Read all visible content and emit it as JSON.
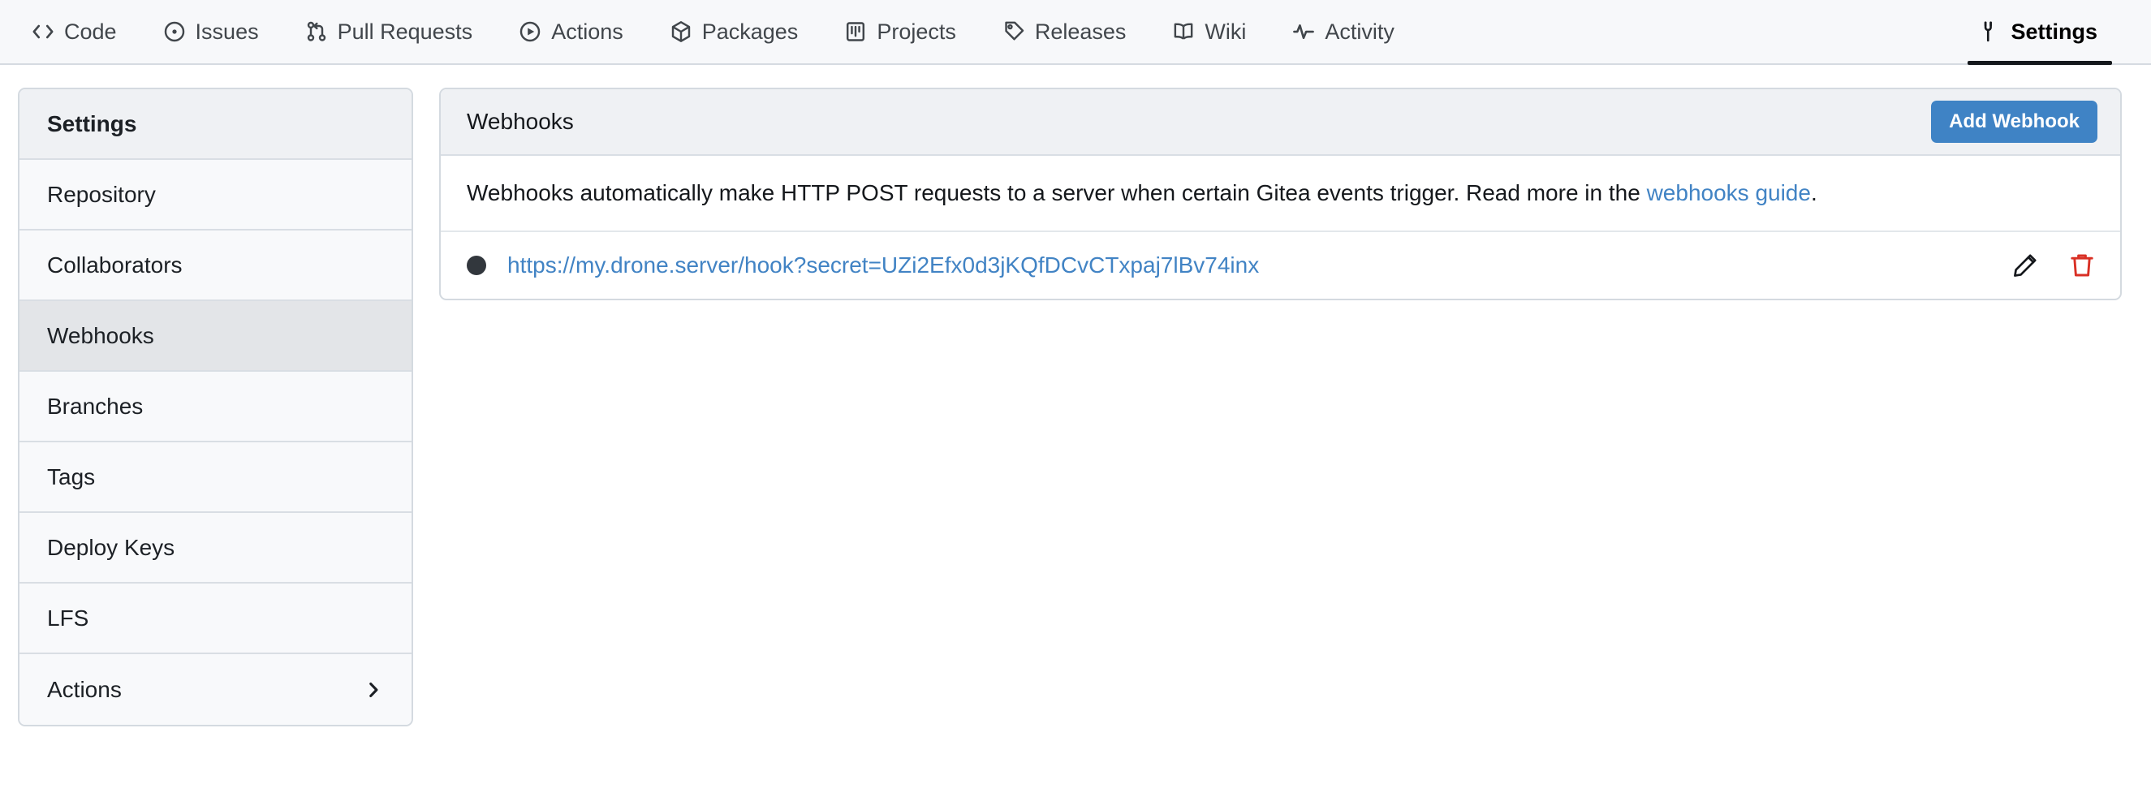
{
  "repo_nav": {
    "items": [
      {
        "label": "Code",
        "icon": "code-icon",
        "active": false
      },
      {
        "label": "Issues",
        "icon": "issue-opened-icon",
        "active": false
      },
      {
        "label": "Pull Requests",
        "icon": "git-pull-request-icon",
        "active": false
      },
      {
        "label": "Actions",
        "icon": "play-icon",
        "active": false
      },
      {
        "label": "Packages",
        "icon": "package-icon",
        "active": false
      },
      {
        "label": "Projects",
        "icon": "project-icon",
        "active": false
      },
      {
        "label": "Releases",
        "icon": "tag-icon",
        "active": false
      },
      {
        "label": "Wiki",
        "icon": "book-icon",
        "active": false
      },
      {
        "label": "Activity",
        "icon": "pulse-icon",
        "active": false
      }
    ],
    "settings": {
      "label": "Settings",
      "icon": "tools-icon",
      "active": true
    }
  },
  "sidebar": {
    "header": "Settings",
    "items": [
      {
        "label": "Repository",
        "active": false,
        "chevron": false
      },
      {
        "label": "Collaborators",
        "active": false,
        "chevron": false
      },
      {
        "label": "Webhooks",
        "active": true,
        "chevron": false
      },
      {
        "label": "Branches",
        "active": false,
        "chevron": false
      },
      {
        "label": "Tags",
        "active": false,
        "chevron": false
      },
      {
        "label": "Deploy Keys",
        "active": false,
        "chevron": false
      },
      {
        "label": "LFS",
        "active": false,
        "chevron": false
      },
      {
        "label": "Actions",
        "active": false,
        "chevron": true
      }
    ]
  },
  "panel": {
    "title": "Webhooks",
    "add_button": "Add Webhook",
    "description": {
      "before_link": "Webhooks automatically make HTTP POST requests to a server when certain Gitea events trigger. Read more in the ",
      "link_text": "webhooks guide",
      "after_link": "."
    },
    "webhooks": [
      {
        "status": "inactive",
        "url": "https://my.drone.server/hook?secret=UZi2Efx0d3jKQfDCvCTxpaj7lBv74inx",
        "edit_icon": "pencil-icon",
        "delete_icon": "trash-icon"
      }
    ]
  },
  "colors": {
    "accent_blue": "#4183c4",
    "button_blue": "#3f83c5",
    "delete_red": "#d93025",
    "status_dot": "#32373d",
    "nav_bg": "#f7f8fa",
    "panel_header_bg": "#eff1f4",
    "active_row_bg": "#e3e5e8",
    "border": "#d4dae0"
  }
}
